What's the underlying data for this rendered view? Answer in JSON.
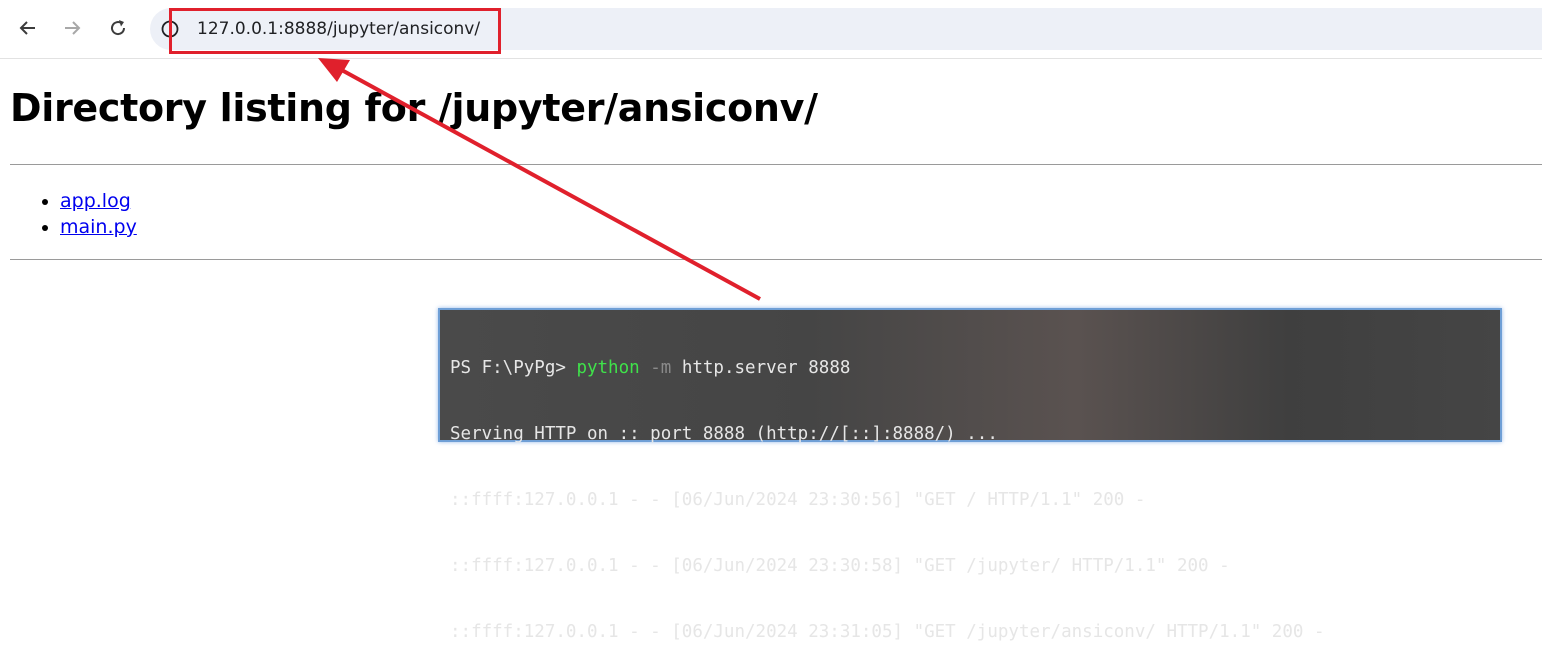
{
  "browser": {
    "back_icon": "arrow-left-icon",
    "forward_icon": "arrow-right-icon",
    "reload_icon": "reload-icon",
    "site_info_icon": "info-circle-icon",
    "url": "127.0.0.1:8888/jupyter/ansiconv/"
  },
  "page": {
    "heading": "Directory listing for /jupyter/ansiconv/",
    "files": [
      "app.log",
      "main.py"
    ]
  },
  "terminal": {
    "prompt": "PS F:\\PyPg> ",
    "command": "python",
    "flag": "-m",
    "args": " http.server 8888",
    "lines": [
      "Serving HTTP on :: port 8888 (http://[::]:8888/) ...",
      "::ffff:127.0.0.1 - - [06/Jun/2024 23:30:56] \"GET / HTTP/1.1\" 200 -",
      "::ffff:127.0.0.1 - - [06/Jun/2024 23:30:58] \"GET /jupyter/ HTTP/1.1\" 200 -",
      "::ffff:127.0.0.1 - - [06/Jun/2024 23:31:05] \"GET /jupyter/ansiconv/ HTTP/1.1\" 200 -"
    ]
  },
  "colors": {
    "annotation": "#e0202c",
    "link": "#0000ee",
    "terminal_green": "#3fe24a"
  }
}
